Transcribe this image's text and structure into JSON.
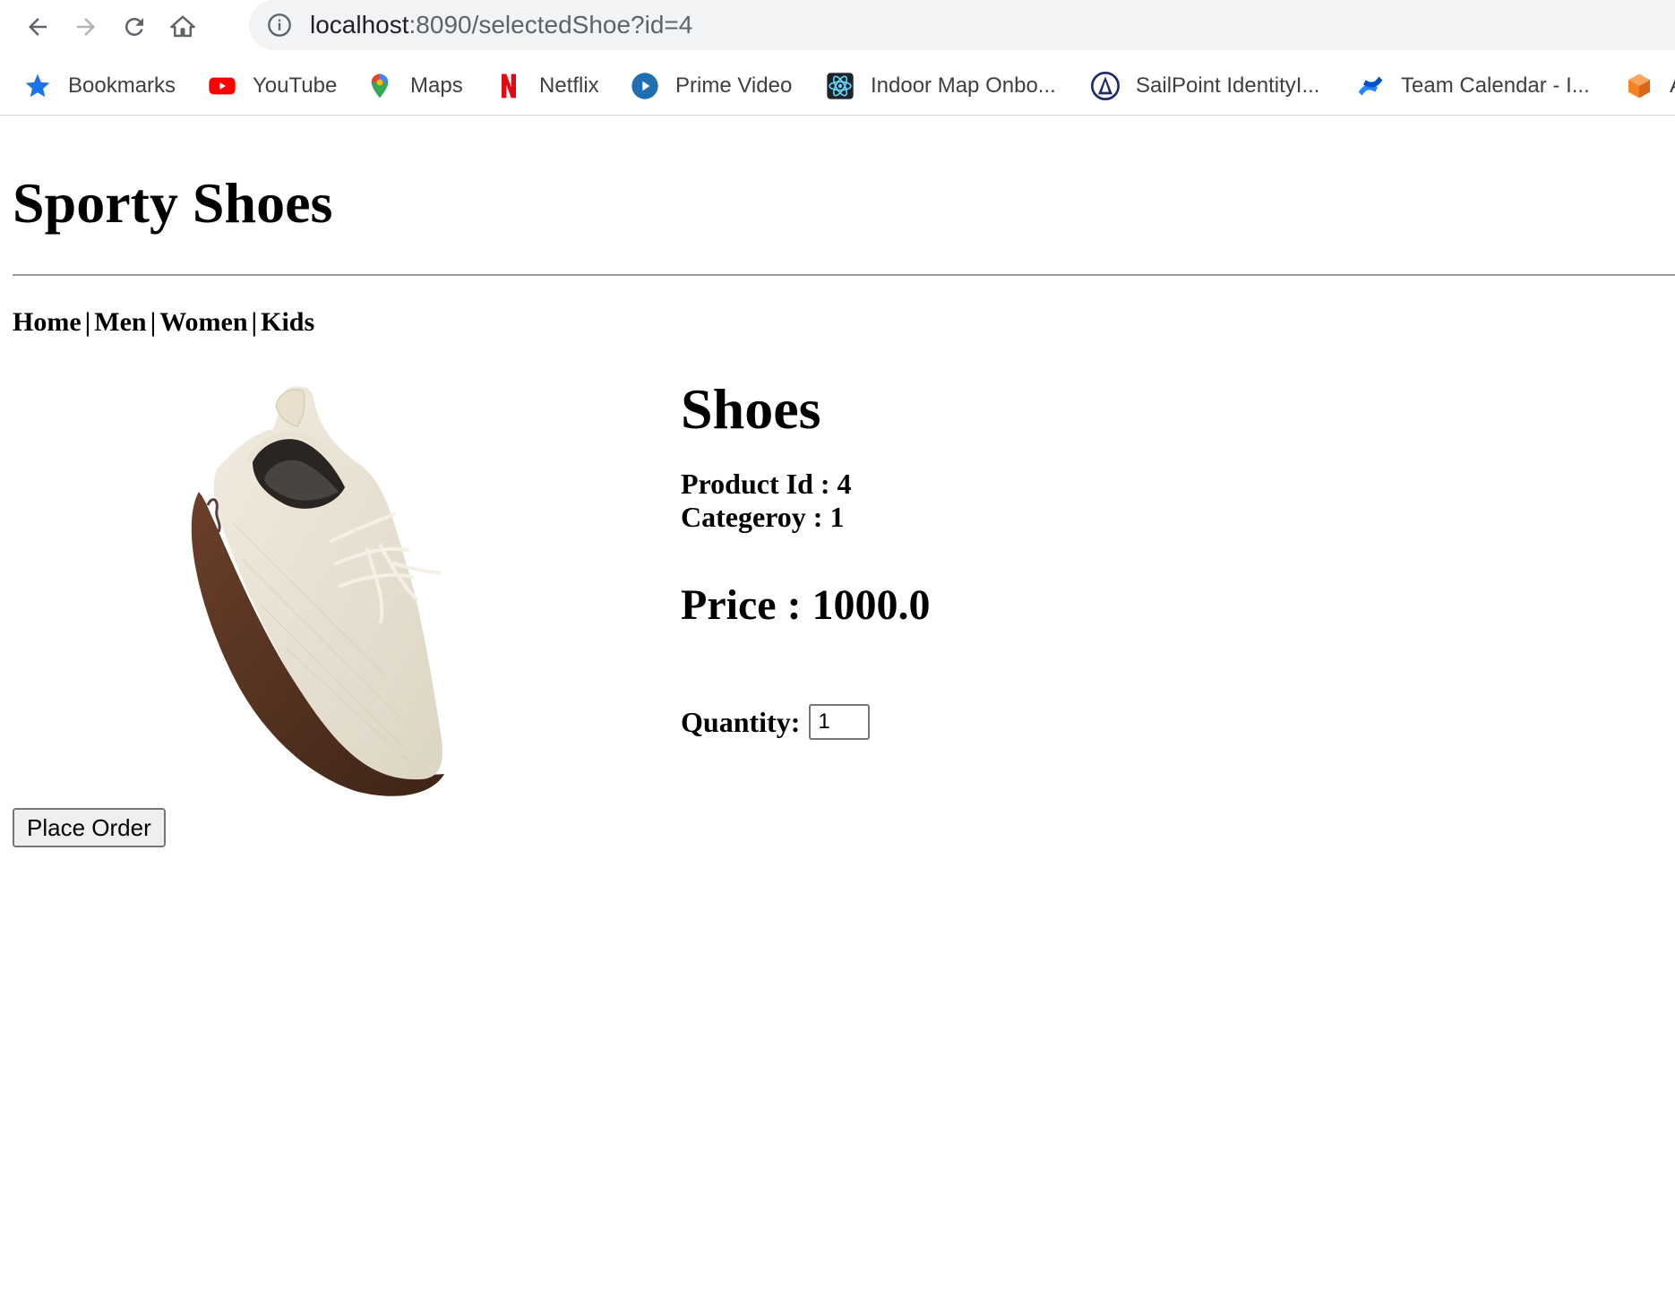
{
  "browser": {
    "url_host": "localhost",
    "url_path": ":8090/selectedShoe?id=4",
    "bookmarks": [
      {
        "label": "Bookmarks",
        "icon": "star-icon"
      },
      {
        "label": "YouTube",
        "icon": "youtube-icon"
      },
      {
        "label": "Maps",
        "icon": "maps-icon"
      },
      {
        "label": "Netflix",
        "icon": "netflix-icon"
      },
      {
        "label": "Prime Video",
        "icon": "prime-video-icon"
      },
      {
        "label": "Indoor Map Onbo...",
        "icon": "react-icon"
      },
      {
        "label": "SailPoint IdentityI...",
        "icon": "sailpoint-icon"
      },
      {
        "label": "Team Calendar - I...",
        "icon": "confluence-icon"
      },
      {
        "label": "A",
        "icon": "cube-icon"
      }
    ]
  },
  "site": {
    "title": "Sporty Shoes",
    "nav": [
      "Home",
      "Men",
      "Women",
      "Kids"
    ],
    "nav_separator": "|"
  },
  "product": {
    "name": "Shoes",
    "id_line": "Product Id : 4",
    "category_line": "Categeroy : 1",
    "price_line": "Price : 1000.0",
    "quantity_label": "Quantity:",
    "quantity_value": "1",
    "image_icon": "shoe-image"
  },
  "actions": {
    "place_order_label": "Place Order"
  }
}
